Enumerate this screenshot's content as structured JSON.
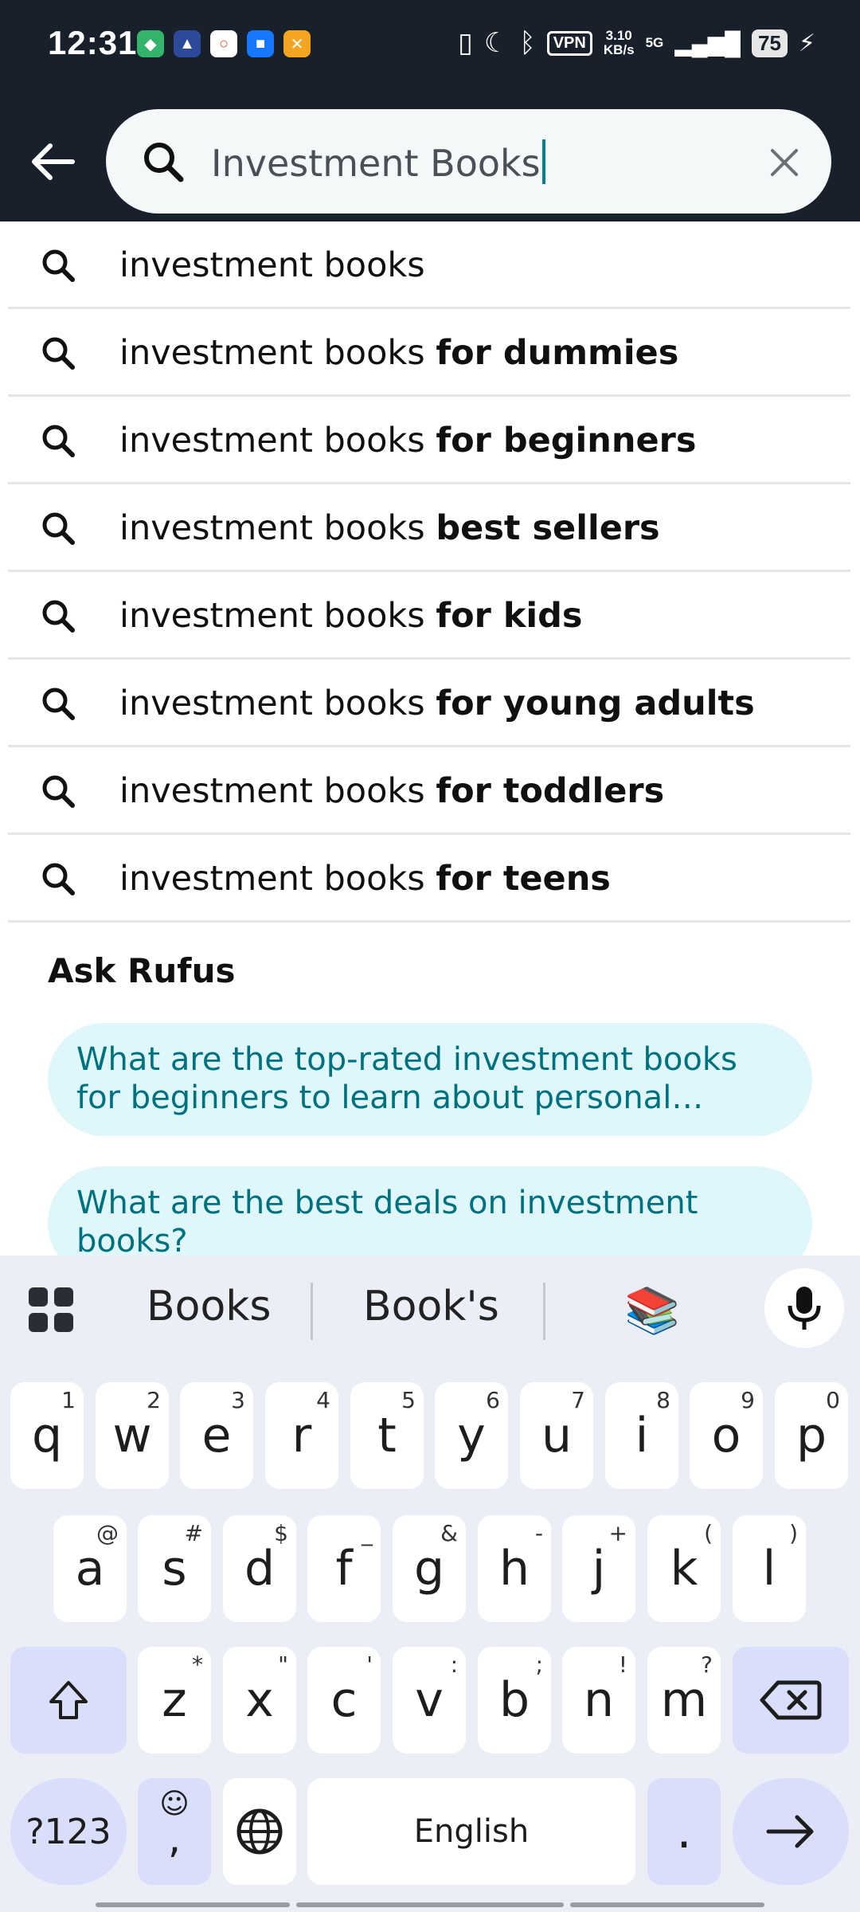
{
  "status_bar": {
    "time": "12:31",
    "vpn": "VPN",
    "speed_value": "3.10",
    "speed_unit": "KB/s",
    "network": "5G",
    "battery": "75"
  },
  "search": {
    "value": "Investment Books"
  },
  "suggestions": [
    {
      "prefix": "investment books",
      "suffix": ""
    },
    {
      "prefix": "investment books",
      "suffix": "for dummies"
    },
    {
      "prefix": "investment books",
      "suffix": "for beginners"
    },
    {
      "prefix": "investment books",
      "suffix": "best sellers"
    },
    {
      "prefix": "investment books",
      "suffix": "for kids"
    },
    {
      "prefix": "investment books",
      "suffix": "for young adults"
    },
    {
      "prefix": "investment books",
      "suffix": "for toddlers"
    },
    {
      "prefix": "investment books",
      "suffix": "for teens"
    }
  ],
  "rufus": {
    "title": "Ask Rufus",
    "questions": [
      "What are the top-rated investment books for beginners to learn about personal…",
      "What are the best deals on investment books?"
    ]
  },
  "keyboard": {
    "suggestions": [
      "Books",
      "Book's"
    ],
    "row1": [
      {
        "key": "q",
        "hint": "1"
      },
      {
        "key": "w",
        "hint": "2"
      },
      {
        "key": "e",
        "hint": "3"
      },
      {
        "key": "r",
        "hint": "4"
      },
      {
        "key": "t",
        "hint": "5"
      },
      {
        "key": "y",
        "hint": "6"
      },
      {
        "key": "u",
        "hint": "7"
      },
      {
        "key": "i",
        "hint": "8"
      },
      {
        "key": "o",
        "hint": "9"
      },
      {
        "key": "p",
        "hint": "0"
      }
    ],
    "row2": [
      {
        "key": "a",
        "hint": "@"
      },
      {
        "key": "s",
        "hint": "#"
      },
      {
        "key": "d",
        "hint": "$"
      },
      {
        "key": "f",
        "hint": "_"
      },
      {
        "key": "g",
        "hint": "&"
      },
      {
        "key": "h",
        "hint": "-"
      },
      {
        "key": "j",
        "hint": "+"
      },
      {
        "key": "k",
        "hint": "("
      },
      {
        "key": "l",
        "hint": ")"
      }
    ],
    "row3": [
      {
        "key": "z",
        "hint": "*"
      },
      {
        "key": "x",
        "hint": "\""
      },
      {
        "key": "c",
        "hint": "'"
      },
      {
        "key": "v",
        "hint": ":"
      },
      {
        "key": "b",
        "hint": ";"
      },
      {
        "key": "n",
        "hint": "!"
      },
      {
        "key": "m",
        "hint": "?"
      }
    ],
    "symbols_key": "?123",
    "comma_key": ",",
    "space_key": "English",
    "period_key": "."
  }
}
